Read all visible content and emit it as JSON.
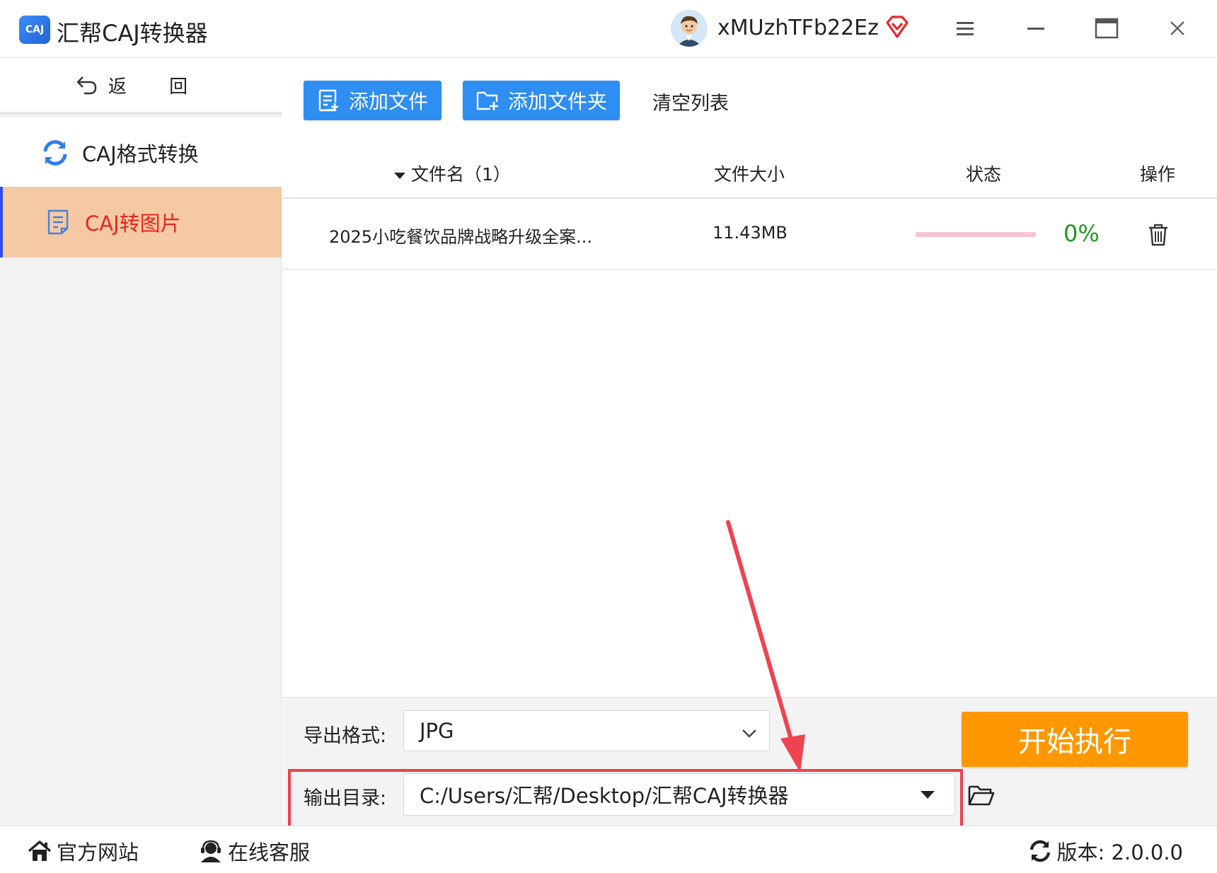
{
  "app": {
    "logo_text": "CAJ",
    "title": "汇帮CAJ转换器",
    "username": "xMUzhTFb22Ez"
  },
  "sidebar": {
    "back_label": "返 回",
    "items": [
      {
        "label": "CAJ格式转换",
        "active": false,
        "icon": "refresh-icon"
      },
      {
        "label": "CAJ转图片",
        "active": true,
        "icon": "document-icon"
      }
    ]
  },
  "toolbar": {
    "add_file_label": "添加文件",
    "add_folder_label": "添加文件夹",
    "clear_list_label": "清空列表"
  },
  "table": {
    "columns": {
      "name": "文件名（1）",
      "size": "文件大小",
      "status": "状态",
      "action": "操作"
    },
    "rows": [
      {
        "name": "2025小吃餐饮品牌战略升级全案...",
        "size": "11.43MB",
        "progress_percent": 0,
        "progress_label": "0%"
      }
    ]
  },
  "settings": {
    "format_label": "导出格式:",
    "format_value": "JPG",
    "output_label": "输出目录:",
    "output_value": "C:/Users/汇帮/Desktop/汇帮CAJ转换器",
    "start_label": "开始执行"
  },
  "statusbar": {
    "official_site": "官方网站",
    "online_support": "在线客服",
    "version": "版本:  2.0.0.0"
  },
  "colors": {
    "primary_blue": "#2e8ef2",
    "active_item_bg": "#f5c9a3",
    "active_item_text": "#e8261f",
    "start_button": "#ff9800",
    "progress_text": "#1e9a1e",
    "highlight_red": "#e9434d"
  }
}
